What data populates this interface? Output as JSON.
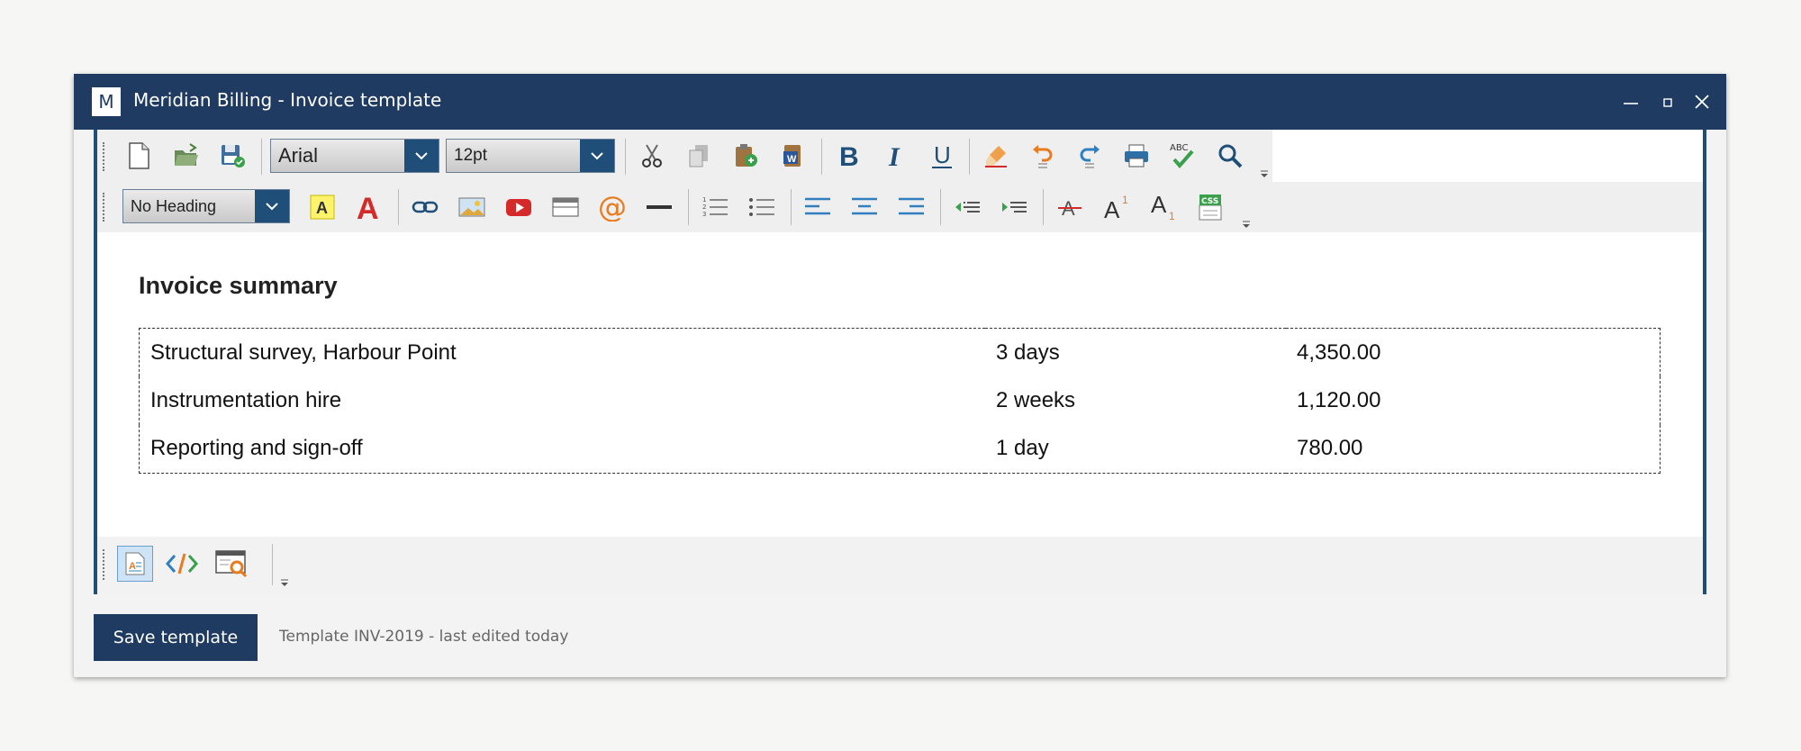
{
  "window": {
    "logo_letter": "M",
    "title": "Meridian Billing - Invoice template"
  },
  "toolbar": {
    "font_name": "Arial",
    "font_size": "12pt",
    "heading_style": "No Heading",
    "spellcheck_label": "ABC",
    "css_label": "CSS"
  },
  "document": {
    "heading": "Invoice summary",
    "rows": [
      {
        "item": "Structural survey, Harbour Point",
        "qty": "3 days",
        "amount": "4,350.00"
      },
      {
        "item": "Instrumentation hire",
        "qty": "2 weeks",
        "amount": "1,120.00"
      },
      {
        "item": "Reporting and sign-off",
        "qty": "1 day",
        "amount": "780.00"
      }
    ]
  },
  "footer": {
    "save_label": "Save template",
    "status": "Template INV-2019 - last edited today"
  },
  "colors": {
    "titlebar": "#1f3b62",
    "accent": "#1f4f78",
    "danger": "#d42a2a",
    "orange": "#e87b1e",
    "green": "#3aa04b"
  }
}
